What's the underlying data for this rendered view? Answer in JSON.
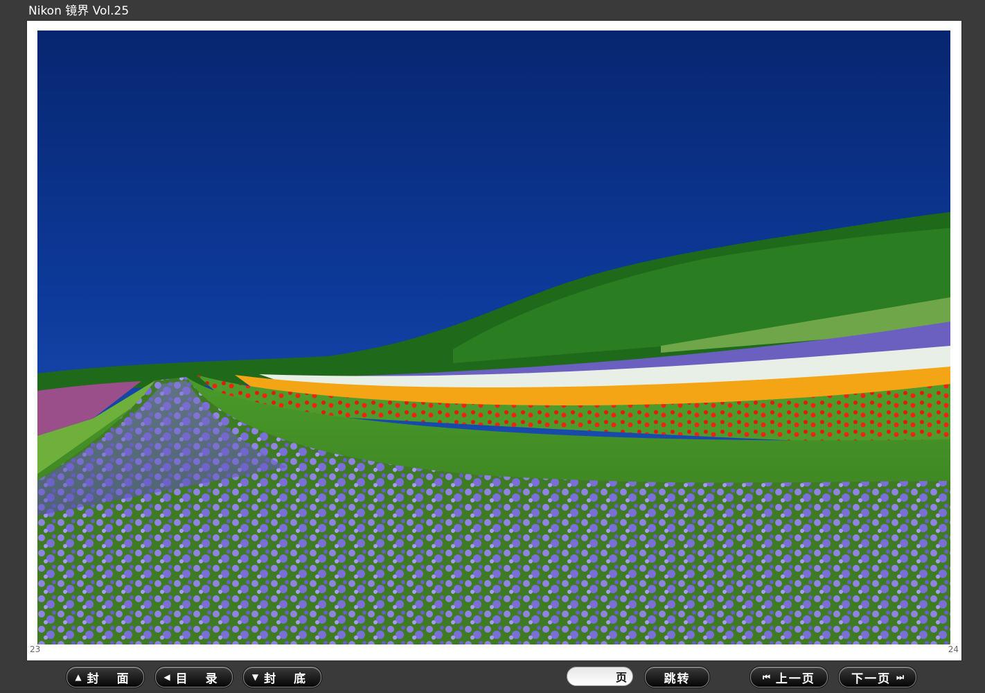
{
  "window": {
    "title": "Nikon 镜界 Vol.25"
  },
  "pages": {
    "left": "23",
    "right": "24"
  },
  "toolbar": {
    "cover_label": "封 面",
    "toc_label": "目 录",
    "back_cover_label": "封 底",
    "page_input_value": "",
    "page_unit": "页",
    "jump_label": "跳转",
    "prev_label": "上一页",
    "next_label": "下一页"
  },
  "icons": {
    "cover": "triangle-up-icon",
    "toc": "triangle-left-icon",
    "back_cover": "triangle-down-icon",
    "prev": "skip-back-icon",
    "next": "skip-forward-icon"
  },
  "colors": {
    "background": "#3a3a3a",
    "sky": "#0a2f86",
    "button_bg": "#111111",
    "button_text": "#ffffff"
  }
}
